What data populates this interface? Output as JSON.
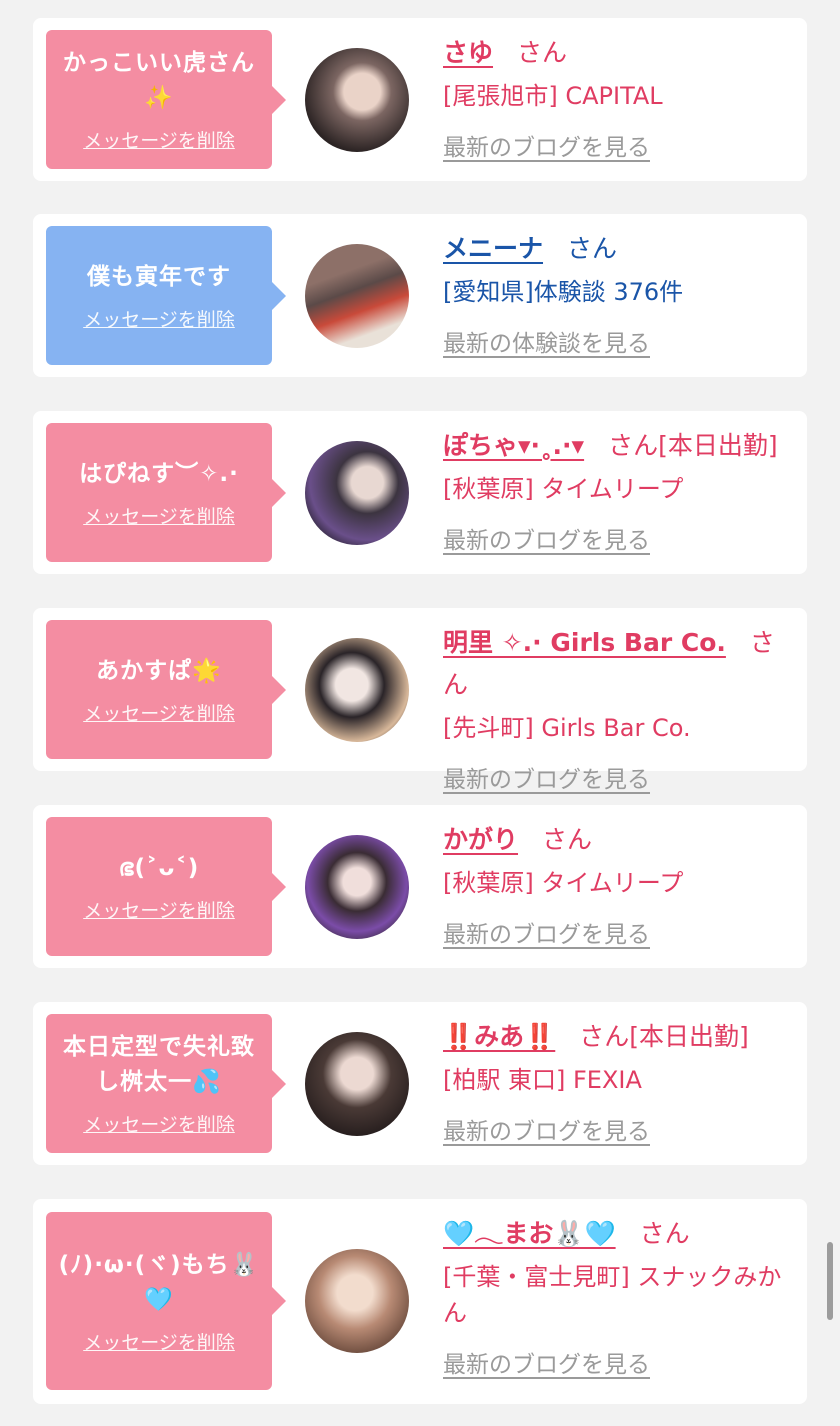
{
  "favorites": [
    {
      "message": "かっこいい虎さん✨",
      "delete_label": "メッセージを削除",
      "bubble_color": "#f48da2",
      "name": "さゆ",
      "honorific": "さん",
      "status": "",
      "shop": "[尾張旭市] CAPITAL",
      "link": "最新のブログを見る",
      "text_color": "#e03c62"
    },
    {
      "message": "僕も寅年です",
      "delete_label": "メッセージを削除",
      "bubble_color": "#86b3f2",
      "name": "メニーナ",
      "honorific": "さん",
      "status": "",
      "shop": "[愛知県]体験談 376件",
      "link": "最新の体験談を見る",
      "text_color": "#1a55a8"
    },
    {
      "message": "はぴねす︶✧.·",
      "delete_label": "メッセージを削除",
      "bubble_color": "#f48da2",
      "name": "ぽちゃ▾·˳.·▾",
      "honorific": "さん",
      "status": "[本日出勤]",
      "shop": "[秋葉原] タイムリープ",
      "link": "最新のブログを見る",
      "text_color": "#e03c62"
    },
    {
      "message": "あかすぱ🌟",
      "delete_label": "メッセージを削除",
      "bubble_color": "#f48da2",
      "name": "明里 ✧.· Girls Bar Co.",
      "honorific": "さん",
      "status": "",
      "shop": "[先斗町] Girls Bar Co.",
      "link": "最新のブログを見る",
      "text_color": "#e03c62"
    },
    {
      "message": "ഭ(˃ᴗ˂)",
      "delete_label": "メッセージを削除",
      "bubble_color": "#f48da2",
      "name": "かがり",
      "honorific": "さん",
      "status": "",
      "shop": "[秋葉原] タイムリープ",
      "link": "最新のブログを見る",
      "text_color": "#e03c62"
    },
    {
      "message": "本日定型で失礼致し桝太一💦",
      "delete_label": "メッセージを削除",
      "bubble_color": "#f48da2",
      "name": "‼️みあ‼️",
      "honorific": "さん",
      "status": "[本日出勤]",
      "shop": "[柏駅 東口] FEXIA",
      "link": "最新のブログを見る",
      "text_color": "#e03c62"
    },
    {
      "message": "(ﾉ)·ω·(ヾ)もち🐰🩵",
      "delete_label": "メッセージを削除",
      "bubble_color": "#f48da2",
      "name": "🩵𓂃まお🐰🩵",
      "honorific": "さん",
      "status": "",
      "shop": "[千葉・富士見町] スナックみかん",
      "link": "最新のブログを見る",
      "text_color": "#e03c62"
    }
  ],
  "icons": {
    "avatar": "profile-photo",
    "scroll": "scrollbar-thumb"
  }
}
